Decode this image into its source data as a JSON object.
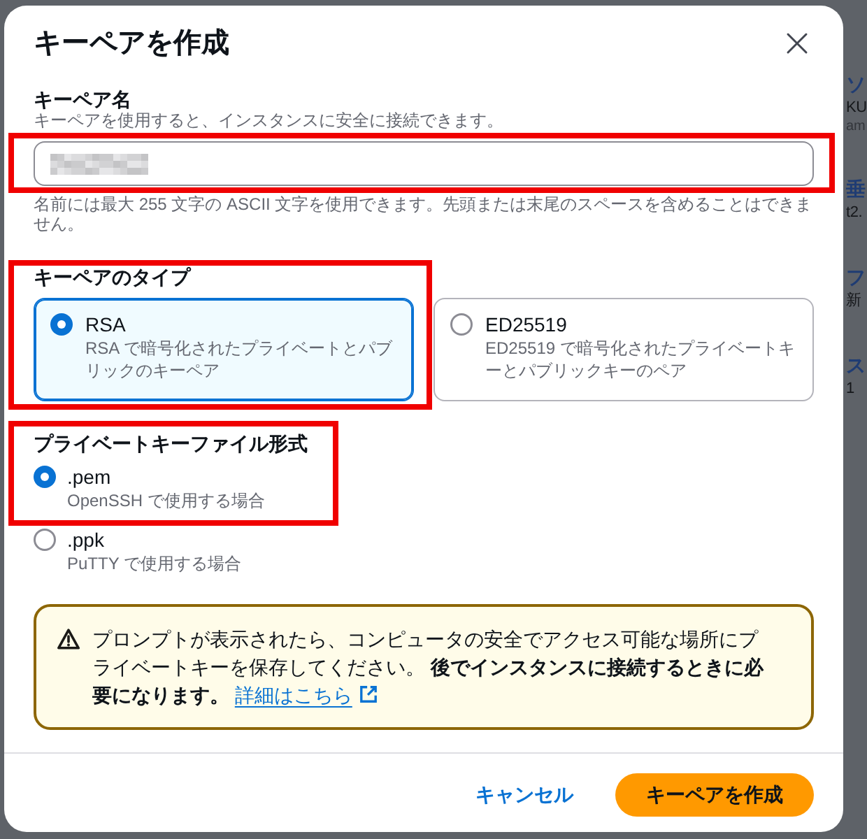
{
  "background_page": {
    "items": [
      {
        "heading": "ソ",
        "value": "KU",
        "sub": "am"
      },
      {
        "heading": "垂",
        "value": "t2."
      },
      {
        "heading": "フ",
        "value": "新"
      },
      {
        "heading": "ス",
        "value": "1"
      }
    ]
  },
  "dialog": {
    "title": "キーペアを作成"
  },
  "key_pair_name": {
    "label": "キーペア名",
    "description": "キーペアを使用すると、インスタンスに安全に接続できます。",
    "value_redacted": true,
    "highlighted": true,
    "constraint": "名前には最大 255 文字の ASCII 文字を使用できます。先頭または末尾のスペースを含めることはできません。"
  },
  "key_type": {
    "label": "キーペアのタイプ",
    "options": [
      {
        "label": "RSA",
        "description": "RSA で暗号化されたプライベートとパブリックのキーペア",
        "selected": true,
        "highlighted": true
      },
      {
        "label": "ED25519",
        "description": "ED25519 で暗号化されたプライベートキーとパブリックキーのペア",
        "selected": false,
        "highlighted": false
      }
    ]
  },
  "file_format": {
    "label": "プライベートキーファイル形式",
    "options": [
      {
        "label": ".pem",
        "description": "OpenSSH で使用する場合",
        "selected": true,
        "highlighted": true
      },
      {
        "label": ".ppk",
        "description": "PuTTY で使用する場合",
        "selected": false,
        "highlighted": false
      }
    ]
  },
  "alert": {
    "kind": "warning",
    "text": "プロンプトが表示されたら、コンピュータの安全でアクセス可能な場所にプライベートキーを保存してください。 **後でインスタンスに接続するときに必要になります。**",
    "link": "詳細はこちら"
  },
  "buttons": [
    {
      "kind": "link",
      "label": "キャンセル"
    },
    {
      "kind": "primary",
      "label": "キーペアを作成"
    }
  ]
}
